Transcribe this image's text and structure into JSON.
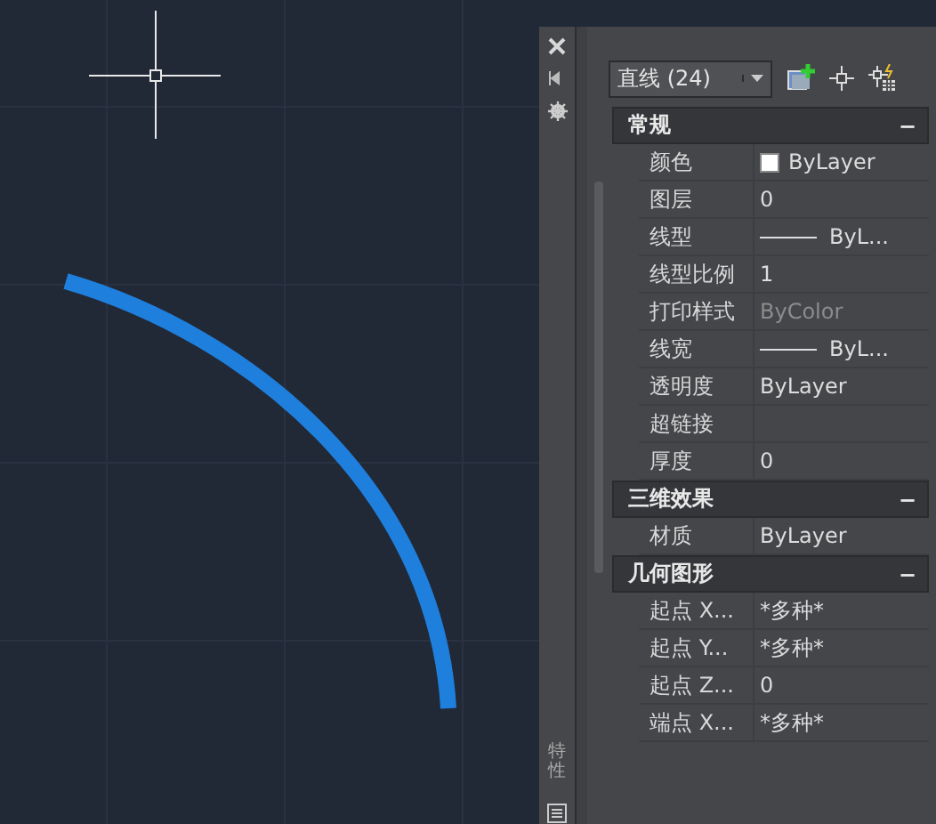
{
  "side_strip": {
    "title": "特性"
  },
  "toolbar": {
    "selection": "直线 (24)"
  },
  "sections": [
    {
      "title": "常规",
      "toggle": "−",
      "rows": [
        {
          "label": "颜色",
          "value": "ByLayer",
          "kind": "color"
        },
        {
          "label": "图层",
          "value": "0",
          "kind": "text"
        },
        {
          "label": "线型",
          "value": "ByL...",
          "kind": "linetype"
        },
        {
          "label": "线型比例",
          "value": "1",
          "kind": "text"
        },
        {
          "label": "打印样式",
          "value": "ByColor",
          "kind": "text",
          "disabled": true
        },
        {
          "label": "线宽",
          "value": "ByL...",
          "kind": "linetype"
        },
        {
          "label": "透明度",
          "value": "ByLayer",
          "kind": "text"
        },
        {
          "label": "超链接",
          "kind": "text"
        },
        {
          "label": "厚度",
          "value": "0",
          "kind": "text"
        }
      ]
    },
    {
      "title": "三维效果",
      "toggle": "−",
      "rows": [
        {
          "label": "材质",
          "value": "ByLayer",
          "kind": "text"
        }
      ]
    },
    {
      "title": "几何图形",
      "toggle": "−",
      "rows": [
        {
          "label": "起点 X...",
          "value": "*多种*",
          "kind": "text"
        },
        {
          "label": "起点 Y...",
          "value": "*多种*",
          "kind": "text"
        },
        {
          "label": "起点 Z...",
          "value": "0",
          "kind": "text"
        },
        {
          "label": "端点 X...",
          "value": "*多种*",
          "kind": "text"
        }
      ]
    }
  ]
}
